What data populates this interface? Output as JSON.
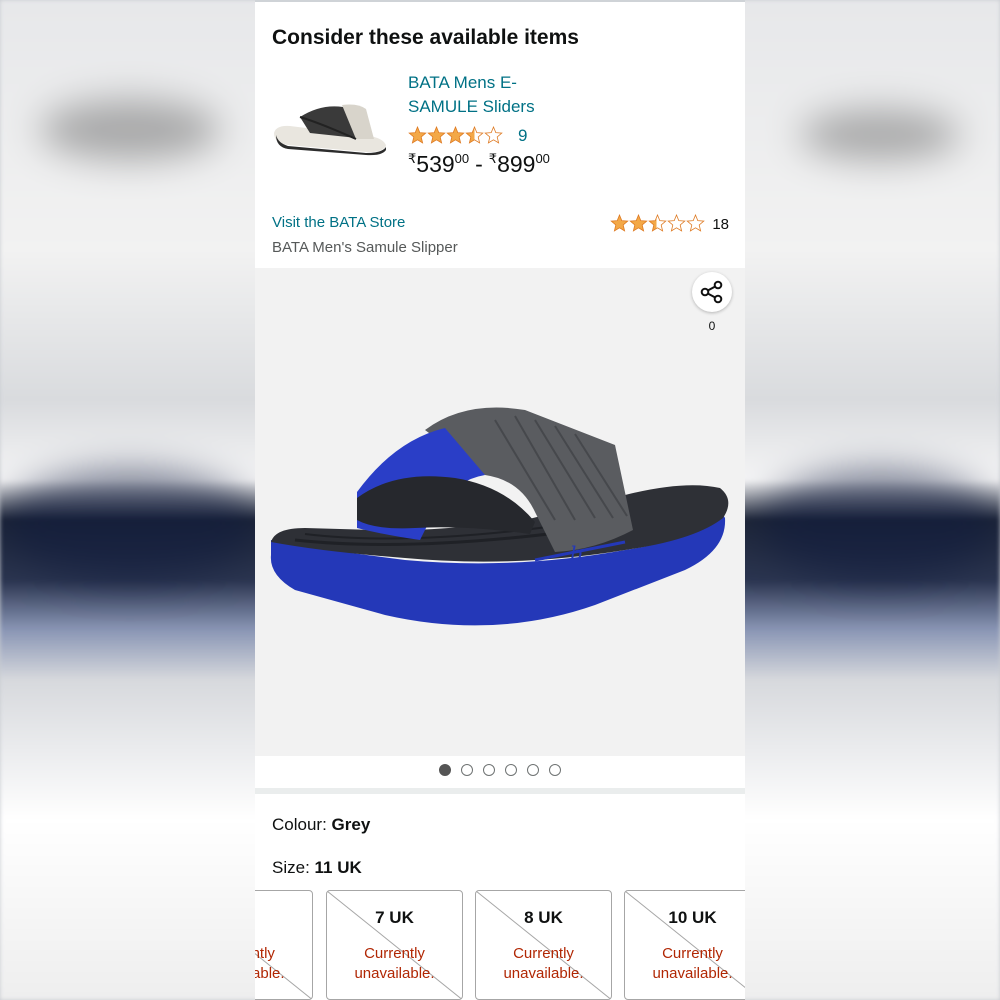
{
  "recommendation": {
    "section_title": "Consider these available items",
    "product_name": "BATA Mens E-SAMULE Sliders",
    "rating_count": "9",
    "price_low": {
      "symbol": "₹",
      "whole": "539",
      "fraction": "00"
    },
    "price_separator": "-",
    "price_high": {
      "symbol": "₹",
      "whole": "899",
      "fraction": "00"
    }
  },
  "product": {
    "store_link": "Visit the BATA Store",
    "title": "BATA Men's Samule Slipper",
    "rating_count": "18",
    "share_count": "0",
    "image_count": 6,
    "active_image": 1
  },
  "variations": {
    "colour_label": "Colour:",
    "colour_value": "Grey",
    "size_label": "Size:",
    "size_value": "11 UK",
    "sizes": [
      {
        "label": "K",
        "status": "Currently unavailable."
      },
      {
        "label": "7 UK",
        "status": "Currently unavailable."
      },
      {
        "label": "8 UK",
        "status": "Currently unavailable."
      },
      {
        "label": "10 UK",
        "status": "Currently unavailable."
      }
    ]
  },
  "colors": {
    "link": "#007185",
    "star": "#f3a847",
    "unavailable": "#b12704"
  }
}
